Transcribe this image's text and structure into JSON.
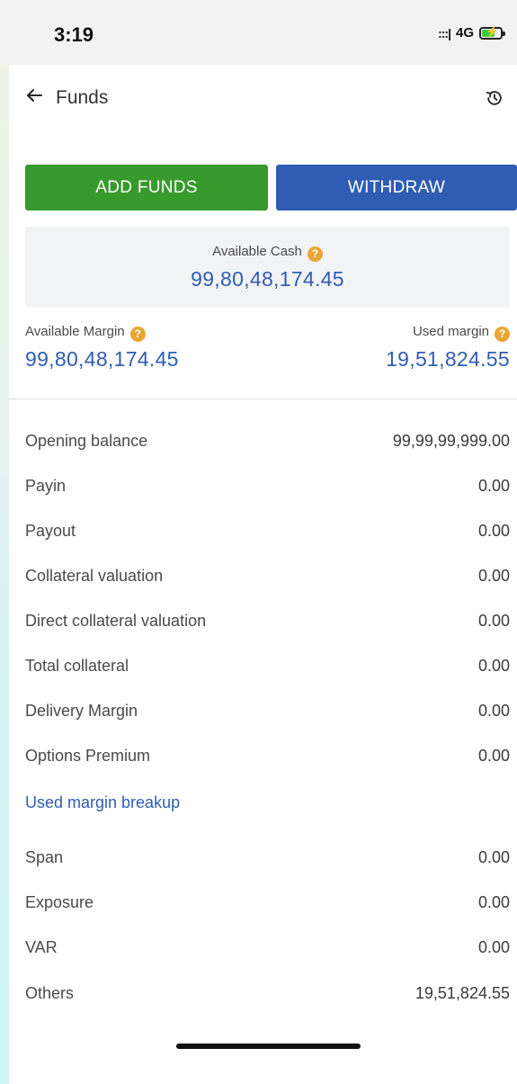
{
  "status_bar": {
    "time": "3:19",
    "signal": ":::|",
    "network": "4G"
  },
  "header": {
    "title": "Funds"
  },
  "actions": {
    "add_funds": "ADD FUNDS",
    "withdraw": "WITHDRAW"
  },
  "available_cash": {
    "label": "Available Cash",
    "value": "99,80,48,174.45"
  },
  "available_margin": {
    "label": "Available Margin",
    "value": "99,80,48,174.45"
  },
  "used_margin": {
    "label": "Used margin",
    "value": "19,51,824.55"
  },
  "help_glyph": "?",
  "details": [
    {
      "label": "Opening balance",
      "value": "99,99,99,999.00"
    },
    {
      "label": "Payin",
      "value": "0.00"
    },
    {
      "label": "Payout",
      "value": "0.00"
    },
    {
      "label": "Collateral valuation",
      "value": "0.00"
    },
    {
      "label": "Direct collateral valuation",
      "value": "0.00"
    },
    {
      "label": "Total collateral",
      "value": "0.00"
    },
    {
      "label": "Delivery Margin",
      "value": "0.00"
    },
    {
      "label": "Options Premium",
      "value": "0.00"
    }
  ],
  "breakup_link": "Used margin breakup",
  "breakup": [
    {
      "label": "Span",
      "value": "0.00"
    },
    {
      "label": "Exposure",
      "value": "0.00"
    },
    {
      "label": "VAR",
      "value": "0.00"
    },
    {
      "label": "Others",
      "value": "19,51,824.55"
    }
  ],
  "colors": {
    "add_funds": "#379a2c",
    "withdraw": "#2f5db3",
    "accent_value": "#2f5db3",
    "help_icon": "#e9a634"
  }
}
